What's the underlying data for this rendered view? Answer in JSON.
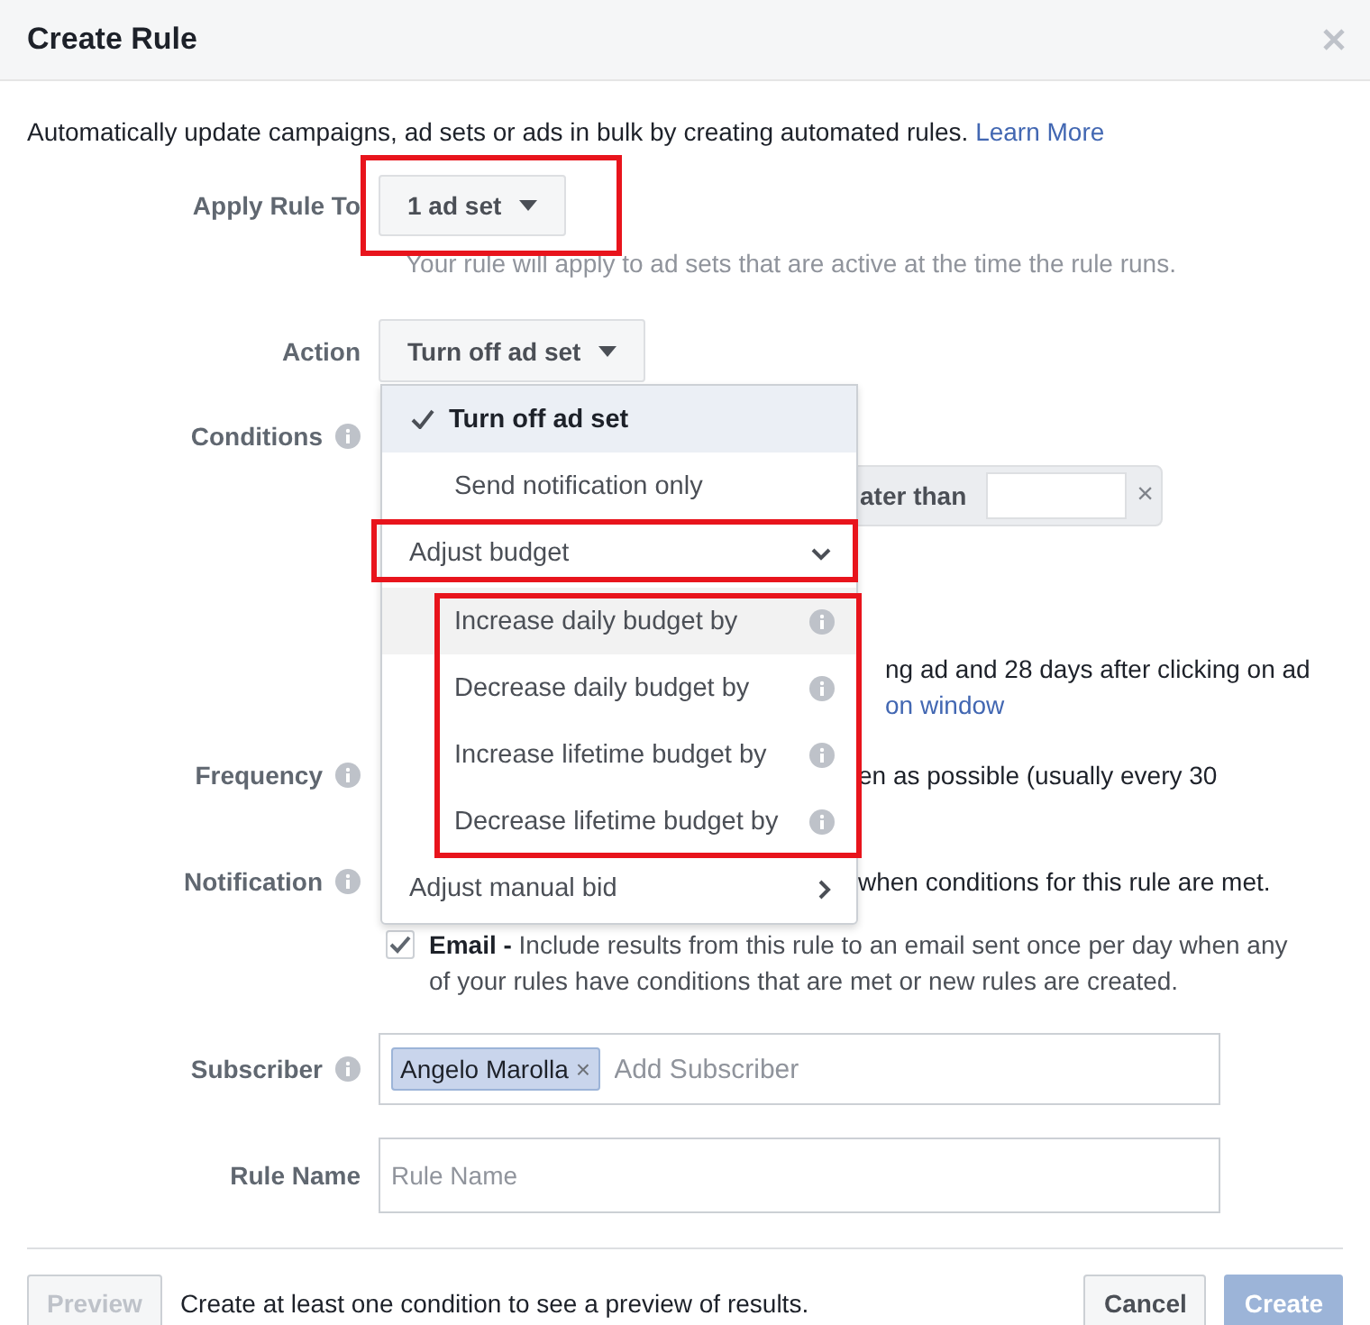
{
  "dialog": {
    "title": "Create Rule"
  },
  "intro": {
    "text": "Automatically update campaigns, ad sets or ads in bulk by creating automated rules.",
    "link": "Learn More"
  },
  "apply_rule_to": {
    "label": "Apply Rule To",
    "value": "1 ad set",
    "hint": "Your rule will apply to ad sets that are active at the time the rule runs."
  },
  "action": {
    "label": "Action",
    "value": "Turn off ad set",
    "menu": [
      {
        "kind": "option",
        "label": "Turn off ad set",
        "selected": true
      },
      {
        "kind": "option",
        "label": "Send notification only",
        "selected": false
      },
      {
        "kind": "group",
        "label": "Adjust budget",
        "expanded": true,
        "children": [
          {
            "label": "Increase daily budget by",
            "highlighted": true
          },
          {
            "label": "Decrease daily budget by",
            "highlighted": false
          },
          {
            "label": "Increase lifetime budget by",
            "highlighted": false
          },
          {
            "label": "Decrease lifetime budget by",
            "highlighted": false
          }
        ]
      },
      {
        "kind": "submenu",
        "label": "Adjust manual bid"
      }
    ]
  },
  "conditions": {
    "label": "Conditions",
    "operator": "ater than",
    "remove": "×"
  },
  "attribution": {
    "text": "ng ad and 28 days after clicking on ad",
    "link": "on window"
  },
  "frequency": {
    "label": "Frequency",
    "text": "en as possible (usually every 30"
  },
  "notification": {
    "label": "Notification",
    "text": "when conditions for this rule are met.",
    "email": {
      "checked": true,
      "text": "**Email -** Include results from this rule to an email sent once per day when any of your rules have conditions that are met or new rules are created."
    }
  },
  "subscriber": {
    "label": "Subscriber",
    "tags": [
      {
        "name": "Angelo Marolla",
        "remove": "×"
      }
    ],
    "placeholder": "Add Subscriber"
  },
  "rule_name": {
    "label": "Rule Name",
    "placeholder": "Rule Name"
  },
  "footer": {
    "preview": {
      "label": "Preview",
      "disabled": true
    },
    "note": "Create at least one condition to see a preview of results.",
    "cancel": "Cancel",
    "create": {
      "label": "Create",
      "disabled": true
    }
  }
}
